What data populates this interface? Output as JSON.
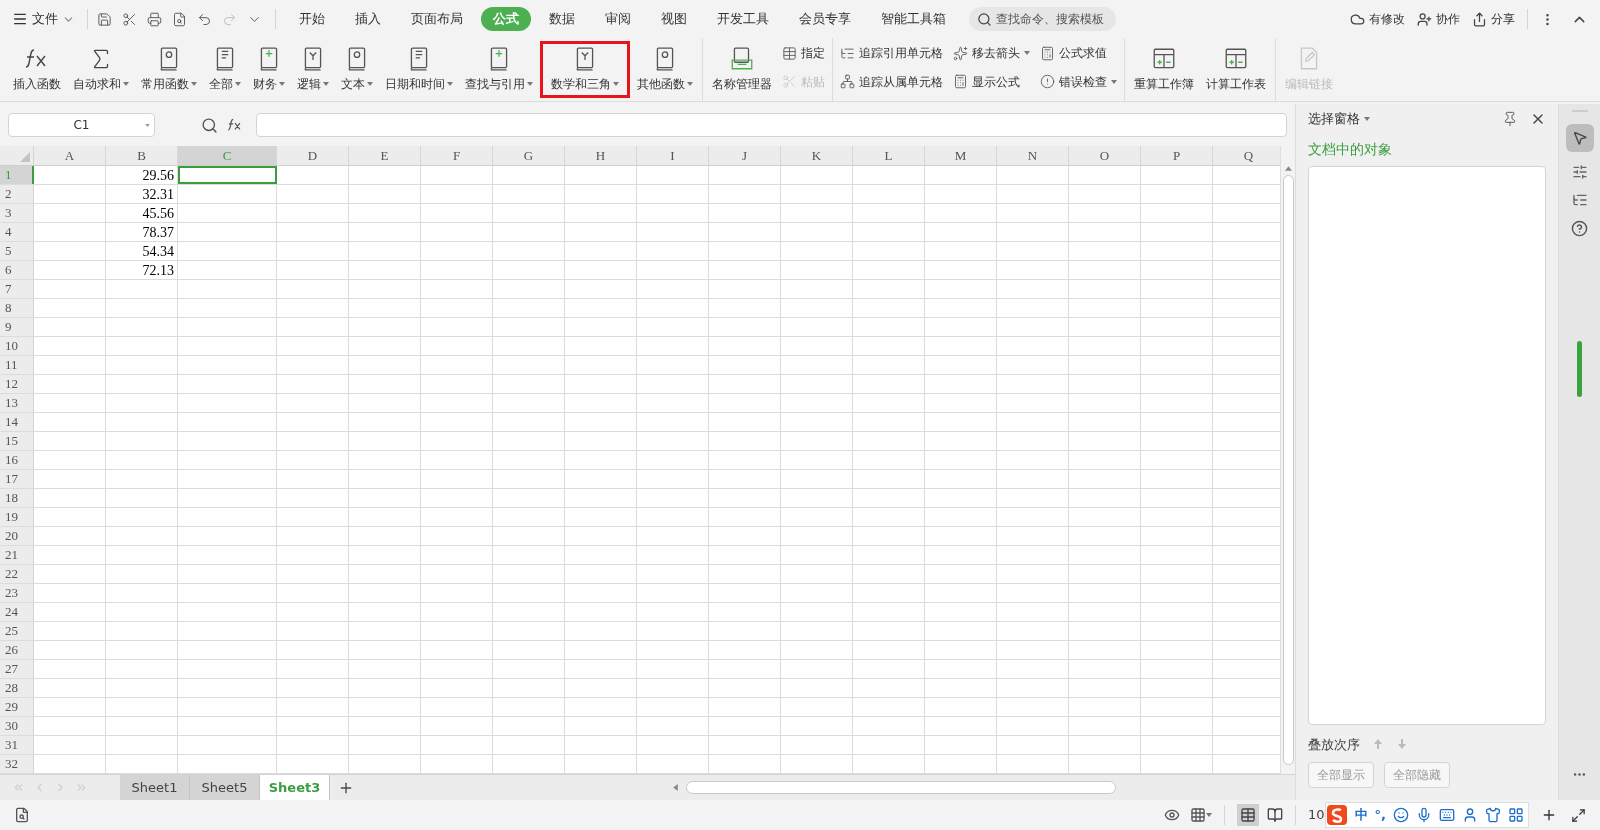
{
  "menu": {
    "file_label": "文件",
    "tabs": [
      {
        "label": "开始",
        "selected": false
      },
      {
        "label": "插入",
        "selected": false
      },
      {
        "label": "页面布局",
        "selected": false
      },
      {
        "label": "公式",
        "selected": true
      },
      {
        "label": "数据",
        "selected": false
      },
      {
        "label": "审阅",
        "selected": false
      },
      {
        "label": "视图",
        "selected": false
      },
      {
        "label": "开发工具",
        "selected": false
      },
      {
        "label": "会员专享",
        "selected": false
      },
      {
        "label": "智能工具箱",
        "selected": false
      }
    ],
    "search": {
      "placeholder": "查找命令、搜索模板"
    },
    "actions": [
      "有修改",
      "协作",
      "分享"
    ]
  },
  "ribbon": {
    "groups": [
      {
        "items": [
          {
            "kind": "large",
            "label": "插入函数",
            "dropdown": false,
            "disabled": false,
            "highlighted": false
          },
          {
            "kind": "large",
            "label": "自动求和",
            "dropdown": true,
            "disabled": false,
            "highlighted": false
          },
          {
            "kind": "large",
            "label": "常用函数",
            "dropdown": true,
            "disabled": false,
            "highlighted": false
          },
          {
            "kind": "large",
            "label": "全部",
            "dropdown": true,
            "disabled": false,
            "highlighted": false
          },
          {
            "kind": "large",
            "label": "财务",
            "dropdown": true,
            "disabled": false,
            "highlighted": false
          },
          {
            "kind": "large",
            "label": "逻辑",
            "dropdown": true,
            "disabled": false,
            "highlighted": false
          },
          {
            "kind": "large",
            "label": "文本",
            "dropdown": true,
            "disabled": false,
            "highlighted": false
          },
          {
            "kind": "large",
            "label": "日期和时间",
            "dropdown": true,
            "disabled": false,
            "highlighted": false
          },
          {
            "kind": "large",
            "label": "查找与引用",
            "dropdown": true,
            "disabled": false,
            "highlighted": false
          },
          {
            "kind": "large",
            "label": "数学和三角",
            "dropdown": true,
            "disabled": false,
            "highlighted": true
          },
          {
            "kind": "large",
            "label": "其他函数",
            "dropdown": true,
            "disabled": false,
            "highlighted": false
          }
        ]
      },
      {
        "items": [
          {
            "kind": "large",
            "label": "名称管理器",
            "dropdown": false,
            "disabled": false,
            "highlighted": false
          },
          {
            "kind": "small",
            "label": "指定",
            "dropdown": false,
            "disabled": false
          },
          {
            "kind": "small",
            "label": "粘贴",
            "dropdown": false,
            "disabled": true
          }
        ]
      },
      {
        "items": [
          {
            "kind": "small",
            "label": "追踪引用单元格",
            "dropdown": false,
            "disabled": false
          },
          {
            "kind": "small",
            "label": "追踪从属单元格",
            "dropdown": false,
            "disabled": false
          },
          {
            "kind": "small",
            "label": "移去箭头",
            "dropdown": true,
            "disabled": false
          },
          {
            "kind": "small",
            "label": "显示公式",
            "dropdown": false,
            "disabled": false
          },
          {
            "kind": "small",
            "label": "公式求值",
            "dropdown": false,
            "disabled": false
          },
          {
            "kind": "small",
            "label": "错误检查",
            "dropdown": true,
            "disabled": false
          }
        ]
      },
      {
        "items": [
          {
            "kind": "large",
            "label": "重算工作簿",
            "dropdown": false,
            "disabled": false,
            "highlighted": false
          },
          {
            "kind": "large",
            "label": "计算工作表",
            "dropdown": false,
            "disabled": false,
            "highlighted": false
          }
        ]
      },
      {
        "items": [
          {
            "kind": "large",
            "label": "编辑链接",
            "dropdown": false,
            "disabled": true,
            "highlighted": false
          }
        ]
      }
    ]
  },
  "formula_bar": {
    "name_box": "C1"
  },
  "table": {
    "columns": [
      {
        "label": "A",
        "selected": false
      },
      {
        "label": "B",
        "selected": false
      },
      {
        "label": "C",
        "selected": true
      },
      {
        "label": "D",
        "selected": false
      },
      {
        "label": "E",
        "selected": false
      },
      {
        "label": "F",
        "selected": false
      },
      {
        "label": "G",
        "selected": false
      },
      {
        "label": "H",
        "selected": false
      },
      {
        "label": "I",
        "selected": false
      },
      {
        "label": "J",
        "selected": false
      },
      {
        "label": "K",
        "selected": false
      },
      {
        "label": "L",
        "selected": false
      },
      {
        "label": "M",
        "selected": false
      },
      {
        "label": "N",
        "selected": false
      },
      {
        "label": "O",
        "selected": false
      },
      {
        "label": "P",
        "selected": false
      },
      {
        "label": "Q",
        "selected": false
      }
    ],
    "rows": [
      {
        "label": "1",
        "selected": true,
        "cells": {
          "B": "29.56"
        }
      },
      {
        "label": "2",
        "selected": false,
        "cells": {
          "B": "32.31"
        }
      },
      {
        "label": "3",
        "selected": false,
        "cells": {
          "B": "45.56"
        }
      },
      {
        "label": "4",
        "selected": false,
        "cells": {
          "B": "78.37"
        }
      },
      {
        "label": "5",
        "selected": false,
        "cells": {
          "B": "54.34"
        }
      },
      {
        "label": "6",
        "selected": false,
        "cells": {
          "B": "72.13"
        }
      },
      {
        "label": "7",
        "selected": false
      },
      {
        "label": "8",
        "selected": false
      },
      {
        "label": "9",
        "selected": false
      },
      {
        "label": "10",
        "selected": false
      },
      {
        "label": "11",
        "selected": false
      },
      {
        "label": "12",
        "selected": false
      },
      {
        "label": "13",
        "selected": false
      },
      {
        "label": "14",
        "selected": false
      },
      {
        "label": "15",
        "selected": false
      },
      {
        "label": "16",
        "selected": false
      },
      {
        "label": "17",
        "selected": false
      },
      {
        "label": "18",
        "selected": false
      },
      {
        "label": "19",
        "selected": false
      },
      {
        "label": "20",
        "selected": false
      },
      {
        "label": "21",
        "selected": false
      },
      {
        "label": "22",
        "selected": false
      },
      {
        "label": "23",
        "selected": false
      },
      {
        "label": "24",
        "selected": false
      },
      {
        "label": "25",
        "selected": false
      },
      {
        "label": "26",
        "selected": false
      },
      {
        "label": "27",
        "selected": false
      },
      {
        "label": "28",
        "selected": false
      },
      {
        "label": "29",
        "selected": false
      },
      {
        "label": "30",
        "selected": false
      },
      {
        "label": "31",
        "selected": false
      },
      {
        "label": "32",
        "selected": false
      }
    ]
  },
  "sheets": [
    {
      "label": "Sheet1",
      "selected": false
    },
    {
      "label": "Sheet5",
      "selected": false
    },
    {
      "label": "Sheet3",
      "selected": true
    }
  ],
  "selection_pane": {
    "title": "选择窗格",
    "section": "文档中的对象",
    "order_label": "叠放次序",
    "buttons": [
      "全部显示",
      "全部隐藏"
    ]
  },
  "status_bar": {
    "zoom": "10",
    "ime_mode": "中",
    "ime_punct": "°,"
  }
}
